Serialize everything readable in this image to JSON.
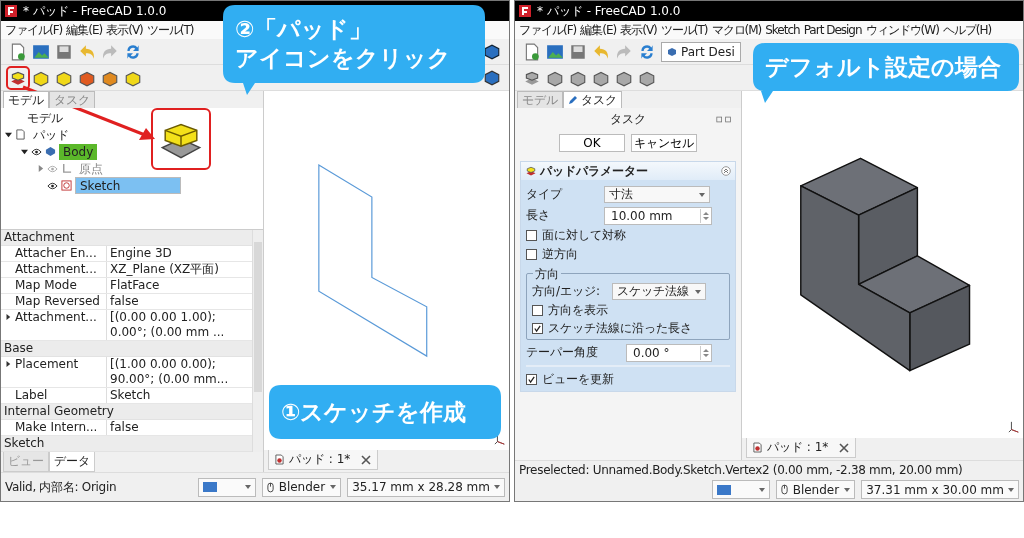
{
  "windows": [
    {
      "title": "* パッド - FreeCAD 1.0.0",
      "menu": [
        "ファイル(F)",
        "編集(E)",
        "表示(V)",
        "ツール(T)"
      ],
      "pad_tool_marked": true,
      "part_tools_enabled": true,
      "panel": {
        "kind": "model",
        "tabs": [
          {
            "label": "モデル",
            "selected": true
          },
          {
            "label": "タスク",
            "selected": false
          }
        ],
        "header": "モデル",
        "tree": [
          {
            "label": "パッド",
            "expanded": true,
            "active": false,
            "hidden": false,
            "selected": false,
            "children": [
              {
                "label": "Body",
                "expanded": true,
                "active": true,
                "hidden": false,
                "selected": false,
                "children": [
                  {
                    "label": "原点",
                    "expanded": false,
                    "active": false,
                    "hidden": true,
                    "selected": false
                  },
                  {
                    "label": "Sketch",
                    "active": false,
                    "hidden": false,
                    "selected": true
                  }
                ]
              }
            ]
          }
        ],
        "properties": [
          {
            "group": "Attachment",
            "rows": [
              {
                "name": "Attacher En...",
                "value": "Engine 3D"
              },
              {
                "name": "Attachment...",
                "value": "XZ_Plane (XZ平面)"
              },
              {
                "name": "Map Mode",
                "value": "FlatFace"
              },
              {
                "name": "Map Reversed",
                "value": "false"
              },
              {
                "name": "Attachment...",
                "value": "[(0.00 0.00 1.00); 0.00°; (0.00 mm ...",
                "expanded": false
              }
            ]
          },
          {
            "group": "Base",
            "rows": [
              {
                "name": "Placement",
                "value": "[(1.00 0.00 0.00); 90.00°; (0.00 mm...",
                "expanded": false
              },
              {
                "name": "Label",
                "value": "Sketch"
              }
            ]
          },
          {
            "group": "Internal Geometry",
            "rows": [
              {
                "name": "Make Intern...",
                "value": "false"
              }
            ]
          },
          {
            "group": "Sketch"
          }
        ],
        "bottom_tabs": [
          {
            "label": "ビュー",
            "selected": false
          },
          {
            "label": "データ",
            "selected": true
          }
        ]
      },
      "view": {
        "kind": "sketch"
      },
      "callouts": [
        {
          "lines": [
            "②「パッド」",
            "アイコンをクリック"
          ]
        },
        {
          "lines": [
            "①スケッチを作成"
          ]
        }
      ],
      "doc_tab": "パッド : 1*",
      "status": "Valid, 内部名: Origin",
      "navigation": "Blender",
      "dimensions": "35.17 mm x 28.28 mm"
    },
    {
      "title": "* パッド - FreeCAD 1.0.0",
      "menu": [
        "ファイル(F)",
        "編集(E)",
        "表示(V)",
        "ツール(T)",
        "マクロ(M)",
        "Sketch",
        "Part Design",
        "ウィンドウ(W)",
        "ヘルプ(H)"
      ],
      "workbench": "Part Desi",
      "pad_tool_marked": false,
      "part_tools_enabled": false,
      "panel": {
        "kind": "task",
        "tabs": [
          {
            "label": "モデル",
            "selected": false
          },
          {
            "label": "タスク",
            "selected": true
          }
        ],
        "header": "タスク",
        "buttons": [
          "OK",
          "キャンセル"
        ],
        "box_title": "パッドパラメーター",
        "params": [
          {
            "kind": "select",
            "label": "タイプ",
            "value": "寸法"
          },
          {
            "kind": "spin",
            "label": "長さ",
            "value": "10.00 mm"
          },
          {
            "kind": "checkbox",
            "label": "面に対して対称",
            "checked": false
          },
          {
            "kind": "checkbox",
            "label": "逆方向",
            "checked": false
          },
          {
            "kind": "group",
            "label": "方向",
            "items": [
              {
                "kind": "select",
                "label": "方向/エッジ:",
                "value": "スケッチ法線"
              },
              {
                "kind": "checkbox",
                "label": "方向を表示",
                "checked": false
              },
              {
                "kind": "checkbox",
                "label": "スケッチ法線に沿った長さ",
                "checked": true
              }
            ]
          },
          {
            "kind": "spin",
            "label": "テーパー角度",
            "value": "0.00 °"
          },
          {
            "kind": "checkbox",
            "label": "ビューを更新",
            "checked": true
          }
        ]
      },
      "view": {
        "kind": "solid"
      },
      "callouts": [
        {
          "lines": [
            "デフォルト設定の場合"
          ]
        }
      ],
      "doc_tab": "パッド : 1*",
      "status": "Preselected: Unnamed.Body.Sketch.Vertex2 (0.00 mm, -2.38 mm, 20.00 mm)",
      "navigation": "Blender",
      "dimensions": "37.31 mm x 30.00 mm"
    }
  ]
}
